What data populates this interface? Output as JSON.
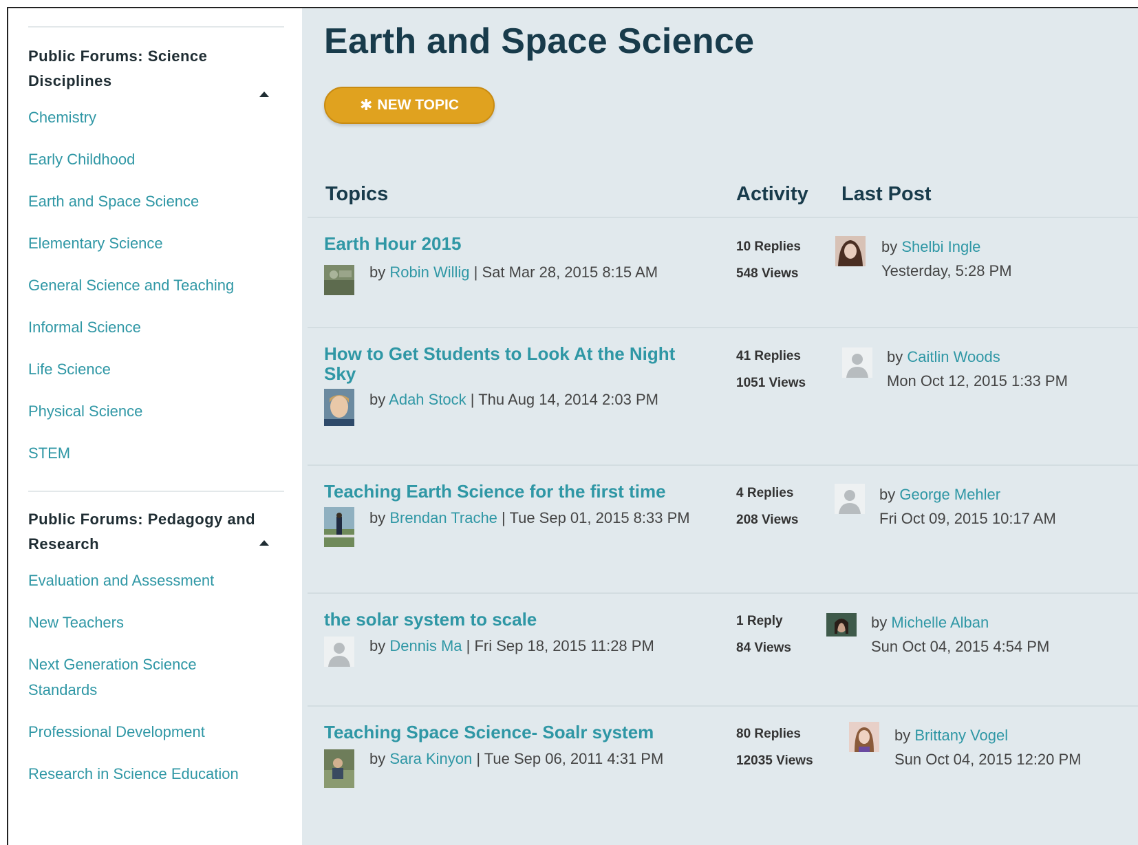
{
  "sidebar": {
    "groups": [
      {
        "title": "Public Forums: Science Disciplines",
        "items": [
          "Chemistry",
          "Early Childhood",
          "Earth and Space Science",
          "Elementary Science",
          "General Science and Teaching",
          "Informal Science",
          "Life Science",
          "Physical Science",
          "STEM"
        ]
      },
      {
        "title": "Public Forums: Pedagogy and Research",
        "items": [
          "Evaluation and Assessment",
          "New Teachers",
          "Next Generation Science Standards",
          "Professional Development",
          "Research in Science Education"
        ]
      }
    ]
  },
  "main": {
    "title": "Earth and Space Science",
    "new_topic_label": "NEW TOPIC",
    "columns": {
      "topics": "Topics",
      "activity": "Activity",
      "last_post": "Last Post"
    },
    "topics": [
      {
        "title": "Earth Hour 2015",
        "by": "by",
        "author": "Robin Willig",
        "date": " | Sat Mar 28, 2015 8:15 AM",
        "replies": "10 Replies",
        "views": "548 Views",
        "last_by": "by",
        "last_author": "Shelbi Ingle",
        "last_date": "Yesterday, 5:28 PM"
      },
      {
        "title": "How to Get Students to Look At the Night Sky",
        "by": "by",
        "author": "Adah Stock",
        "date": " | Thu Aug 14, 2014 2:03 PM",
        "replies": "41 Replies",
        "views": "1051 Views",
        "last_by": "by",
        "last_author": "Caitlin Woods",
        "last_date": "Mon Oct 12, 2015 1:33 PM"
      },
      {
        "title": "Teaching Earth Science for the first time",
        "by": "by",
        "author": "Brendan Trache",
        "date": " | Tue Sep 01, 2015 8:33 PM",
        "replies": "4 Replies",
        "views": "208 Views",
        "last_by": "by",
        "last_author": "George Mehler",
        "last_date": "Fri Oct 09, 2015 10:17 AM"
      },
      {
        "title": "the solar system to scale",
        "by": "by",
        "author": "Dennis Ma",
        "date": " | Fri Sep 18, 2015 11:28 PM",
        "replies": "1 Reply",
        "views": "84 Views",
        "last_by": "by",
        "last_author": "Michelle Alban",
        "last_date": "Sun Oct 04, 2015 4:54 PM"
      },
      {
        "title": "Teaching Space Science- Soalr system",
        "by": "by",
        "author": "Sara Kinyon",
        "date": " | Tue Sep 06, 2011 4:31 PM",
        "replies": "80 Replies",
        "views": "12035 Views",
        "last_by": "by",
        "last_author": "Brittany Vogel",
        "last_date": "Sun Oct 04, 2015 12:20 PM"
      }
    ]
  },
  "colors": {
    "accent_teal": "#2f97a5",
    "button_orange": "#e0a21f",
    "title_navy": "#183b4b",
    "main_bg": "#e1e9ed"
  }
}
